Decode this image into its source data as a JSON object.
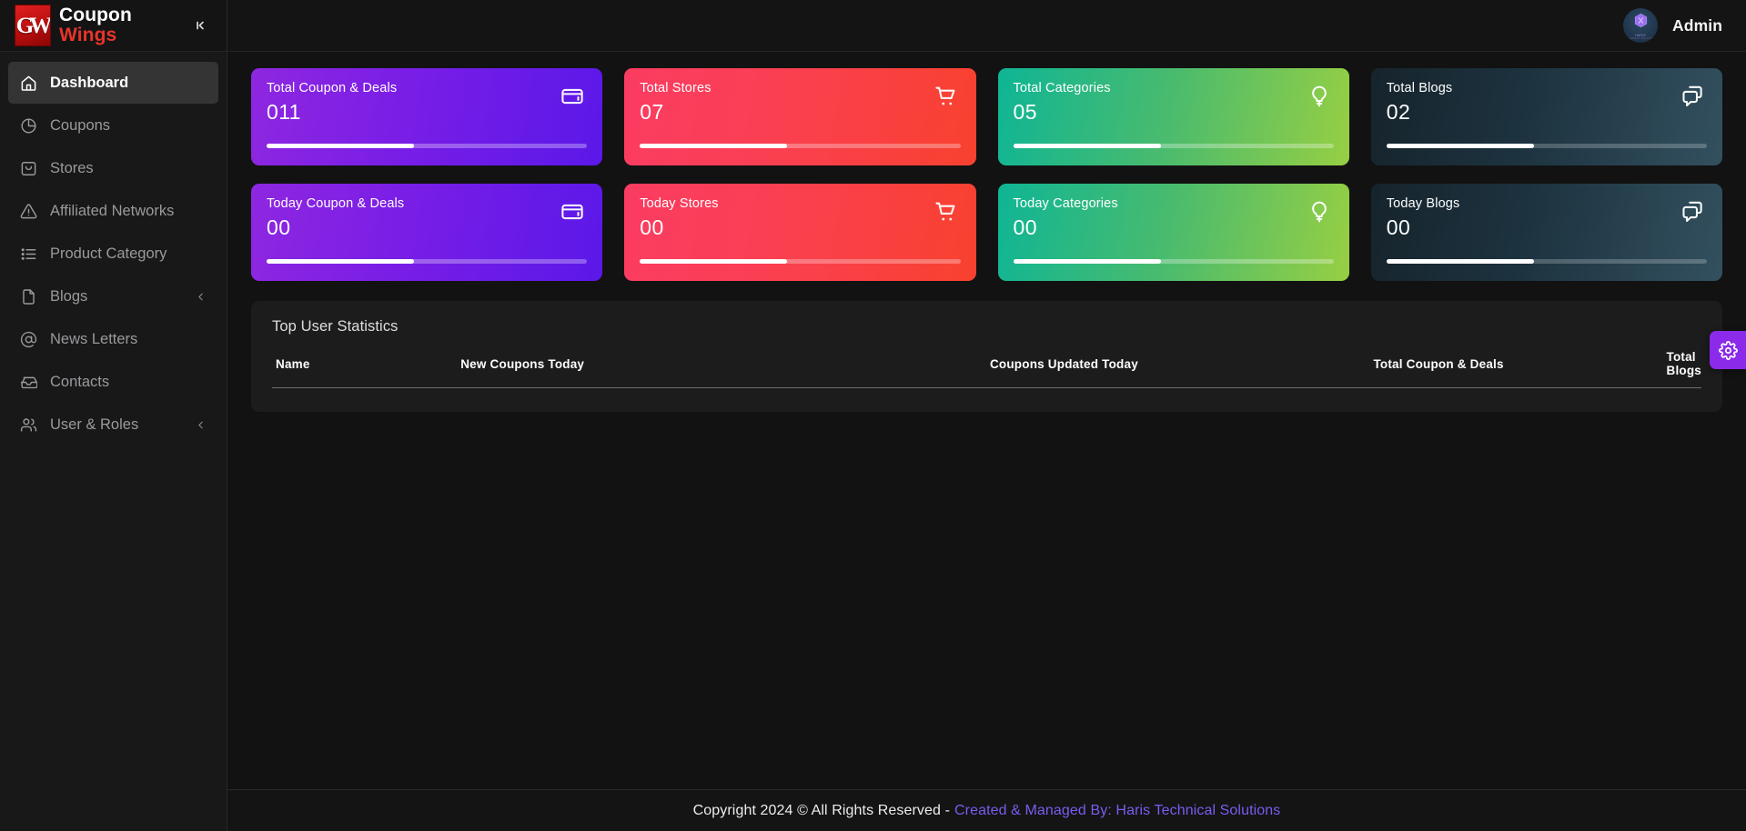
{
  "brand": {
    "line1": "Coupon",
    "line2": "Wings",
    "logo_glyph": "GW",
    "collapse_icon": "chevron-first-icon"
  },
  "sidebar": {
    "items": [
      {
        "label": "Dashboard",
        "icon": "home-icon",
        "active": true,
        "chevron": false
      },
      {
        "label": "Coupons",
        "icon": "pie-chart-icon",
        "active": false,
        "chevron": false
      },
      {
        "label": "Stores",
        "icon": "bag-icon",
        "active": false,
        "chevron": false
      },
      {
        "label": "Affiliated Networks",
        "icon": "warning-icon",
        "active": false,
        "chevron": false
      },
      {
        "label": "Product Category",
        "icon": "list-icon",
        "active": false,
        "chevron": false
      },
      {
        "label": "Blogs",
        "icon": "file-icon",
        "active": false,
        "chevron": true
      },
      {
        "label": "News Letters",
        "icon": "at-sign-icon",
        "active": false,
        "chevron": false
      },
      {
        "label": "Contacts",
        "icon": "inbox-icon",
        "active": false,
        "chevron": false
      },
      {
        "label": "User & Roles",
        "icon": "users-icon",
        "active": false,
        "chevron": true
      }
    ]
  },
  "topbar": {
    "admin_label": "Admin",
    "avatar": {
      "title": "HARIS",
      "subtitle": "TECHNICAL SOLUTIONS"
    }
  },
  "cards": [
    {
      "title": "Total Coupon & Deals",
      "value": "011",
      "icon": "wallet-icon",
      "theme": "c-purple",
      "progress": 46
    },
    {
      "title": "Total Stores",
      "value": "07",
      "icon": "cart-icon",
      "theme": "c-red",
      "progress": 46
    },
    {
      "title": "Total Categories",
      "value": "05",
      "icon": "bulb-icon",
      "theme": "c-green",
      "progress": 46
    },
    {
      "title": "Total Blogs",
      "value": "02",
      "icon": "chat-icon",
      "theme": "c-dark",
      "progress": 46
    },
    {
      "title": "Today Coupon & Deals",
      "value": "00",
      "icon": "wallet-icon",
      "theme": "c-purple",
      "progress": 46
    },
    {
      "title": "Today Stores",
      "value": "00",
      "icon": "cart-icon",
      "theme": "c-red",
      "progress": 46
    },
    {
      "title": "Today Categories",
      "value": "00",
      "icon": "bulb-icon",
      "theme": "c-green",
      "progress": 46
    },
    {
      "title": "Today Blogs",
      "value": "00",
      "icon": "chat-icon",
      "theme": "c-dark",
      "progress": 46
    }
  ],
  "panel": {
    "title": "Top User Statistics",
    "columns": [
      "Name",
      "New Coupons Today",
      "Coupons Updated Today",
      "Total Coupon & Deals",
      "Total Blogs"
    ],
    "rows": []
  },
  "settings_tab": {
    "icon": "gear-icon",
    "color": "#8b2ae8"
  },
  "footer": {
    "text": "Copyright 2024 © All Rights Reserved -",
    "credit": "Created & Managed By: Haris Technical Solutions"
  }
}
